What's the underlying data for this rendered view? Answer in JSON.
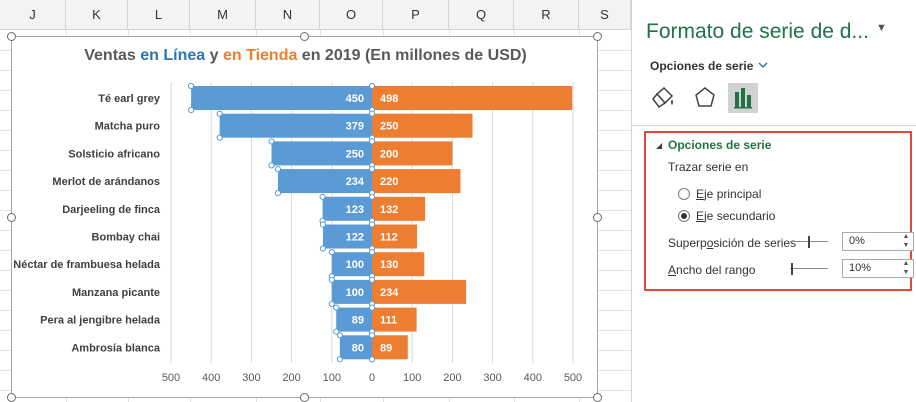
{
  "sheet": {
    "columns": [
      "J",
      "K",
      "L",
      "M",
      "N",
      "O",
      "P",
      "Q",
      "R",
      "S"
    ]
  },
  "chart": {
    "title": {
      "part1": "Ventas ",
      "blue_text": "en Línea",
      "part2": " y ",
      "orange_text": "en Tienda",
      "part3": " en 2019 (En millones de USD)"
    }
  },
  "chart_data": {
    "type": "bar",
    "orientation": "horizontal",
    "categories": [
      "Té earl grey",
      "Matcha puro",
      "Solsticio africano",
      "Merlot de arándanos",
      "Darjeeling de finca",
      "Bombay chai",
      "Néctar de frambuesa helada",
      "Manzana picante",
      "Pera al jengibre helada",
      "Ambrosía blanca"
    ],
    "series": [
      {
        "values": [
          450,
          379,
          250,
          234,
          123,
          122,
          100,
          100,
          89,
          80
        ],
        "color": "#5b9bd5",
        "direction": "left"
      },
      {
        "values": [
          498,
          250,
          200,
          220,
          132,
          112,
          130,
          234,
          111,
          89
        ],
        "color": "#ed7d31",
        "direction": "right"
      }
    ],
    "x_ticks": [
      "500",
      "400",
      "300",
      "200",
      "100",
      "0",
      "100",
      "200",
      "300",
      "400",
      "500"
    ],
    "xlim": [
      -500,
      500
    ],
    "grid": true,
    "data_labels": true
  },
  "pane": {
    "title": "Formato de serie de d...",
    "close_glyph": "▼",
    "subtitle": "Opciones de serie",
    "section": {
      "title": "Opciones de serie",
      "trazar_label": "Trazar serie en",
      "radio_principal_pre": "",
      "radio_principal_ul": "E",
      "radio_principal_post": "je principal",
      "radio_secundario_pre": "",
      "radio_secundario_ul": "E",
      "radio_secundario_post": "je secundario",
      "secundario_selected": true,
      "overlap_label_pre": "Superp",
      "overlap_label_ul": "o",
      "overlap_label_post": "sición de series",
      "overlap_value": "0%",
      "overlap_level": 0.5,
      "gap_label_pre": "",
      "gap_label_ul": "A",
      "gap_label_post": "ncho del rango",
      "gap_value": "10%",
      "gap_level": 0.02
    }
  },
  "colors": {
    "accent": "#217346",
    "online": "#5b9bd5",
    "store": "#ed7d31",
    "highlight_box": "#e8473f"
  }
}
